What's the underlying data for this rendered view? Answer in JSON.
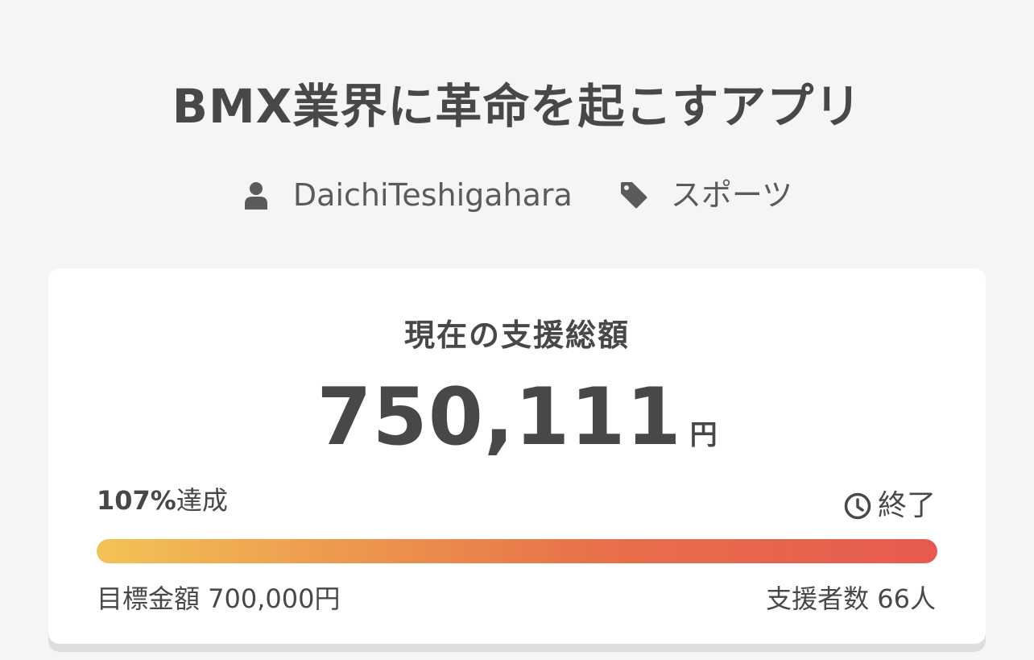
{
  "project": {
    "title": "BMX業界に革命を起こすアプリ",
    "author": "DaichiTeshigahara",
    "category": "スポーツ"
  },
  "funding": {
    "label": "現在の支援総額",
    "amount": "750,111",
    "currency_unit": "円",
    "percent_text": "107%",
    "achieve_suffix": "達成",
    "achievement_ratio": 1.07,
    "status": "終了",
    "goal_text": "目標金額 700,000円",
    "backers_text": "支援者数 66人"
  },
  "icons": {
    "author": "user-icon",
    "category": "tag-icon",
    "status": "clock-icon"
  },
  "colors": {
    "text": "#4a4748",
    "background": "#f4f5f7",
    "progress_start": "#f3c356",
    "progress_end": "#e75a4f"
  }
}
